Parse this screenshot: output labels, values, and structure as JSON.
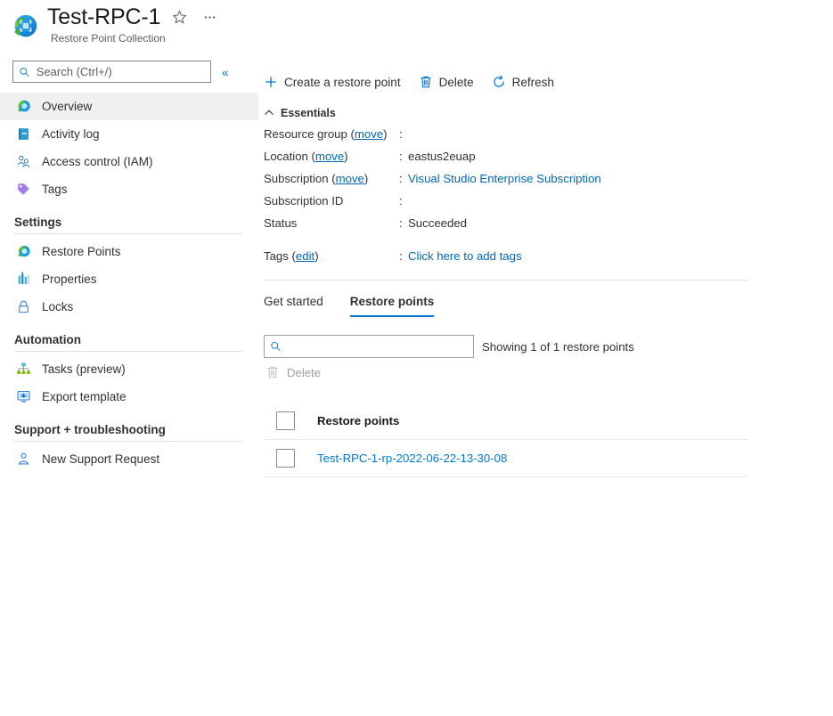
{
  "header": {
    "title": "Test-RPC-1",
    "subtitle": "Restore Point Collection",
    "favorite_icon": "star-icon",
    "more_icon": "ellipsis-icon"
  },
  "sidebar": {
    "search": {
      "placeholder": "Search (Ctrl+/)",
      "value": ""
    },
    "collapse_label": "«",
    "items": [
      {
        "label": "Overview",
        "icon": "overview-icon",
        "selected": true
      },
      {
        "label": "Activity log",
        "icon": "activity-log-icon",
        "selected": false
      },
      {
        "label": "Access control (IAM)",
        "icon": "access-control-icon",
        "selected": false
      },
      {
        "label": "Tags",
        "icon": "tags-icon",
        "selected": false
      }
    ],
    "groups": [
      {
        "title": "Settings",
        "items": [
          {
            "label": "Restore Points",
            "icon": "restore-points-icon"
          },
          {
            "label": "Properties",
            "icon": "properties-icon"
          },
          {
            "label": "Locks",
            "icon": "lock-icon"
          }
        ]
      },
      {
        "title": "Automation",
        "items": [
          {
            "label": "Tasks (preview)",
            "icon": "tasks-icon"
          },
          {
            "label": "Export template",
            "icon": "export-template-icon"
          }
        ]
      },
      {
        "title": "Support + troubleshooting",
        "items": [
          {
            "label": "New Support Request",
            "icon": "support-request-icon"
          }
        ]
      }
    ]
  },
  "commandbar": [
    {
      "label": "Create a restore point",
      "icon": "plus-icon"
    },
    {
      "label": "Delete",
      "icon": "trash-icon"
    },
    {
      "label": "Refresh",
      "icon": "refresh-icon"
    }
  ],
  "essentials": {
    "heading": "Essentials",
    "chevron": "chevron-up-icon",
    "rows": [
      {
        "key": "Resource group",
        "link": "move",
        "colon": ":",
        "value": "",
        "redacted": true,
        "value_is_link": false
      },
      {
        "key": "Location",
        "link": "move",
        "colon": ":",
        "value": "eastus2euap",
        "redacted": false,
        "value_is_link": false
      },
      {
        "key": "Subscription",
        "link": "move",
        "colon": ":",
        "value": "Visual Studio Enterprise Subscription",
        "redacted": false,
        "value_is_link": true
      },
      {
        "key": "Subscription ID",
        "link": "",
        "colon": ":",
        "value": "",
        "redacted": true,
        "value_is_link": false
      },
      {
        "key": "Status",
        "link": "",
        "colon": ":",
        "value": "Succeeded",
        "redacted": false,
        "value_is_link": false
      }
    ],
    "tags": {
      "key": "Tags",
      "link": "edit",
      "colon": ":",
      "value": "Click here to add tags"
    }
  },
  "tabs": [
    {
      "label": "Get started",
      "active": false
    },
    {
      "label": "Restore points",
      "active": true
    }
  ],
  "filter": {
    "search": {
      "placeholder": "",
      "value": "",
      "icon": "search-icon"
    },
    "showing": "Showing 1 of 1 restore points",
    "delete": {
      "label": "Delete",
      "icon": "trash-icon",
      "disabled": true
    }
  },
  "table": {
    "columns": [
      "Restore points"
    ],
    "rows": [
      {
        "name": "Test-RPC-1-rp-2022-06-22-13-30-08",
        "checked": false
      }
    ]
  },
  "colors": {
    "accent": "#0078d4",
    "link": "#0067b8",
    "selected_row_bg": "#f0f0f0",
    "divider": "#e1dfdd",
    "disabled_text": "#a19f9d"
  }
}
